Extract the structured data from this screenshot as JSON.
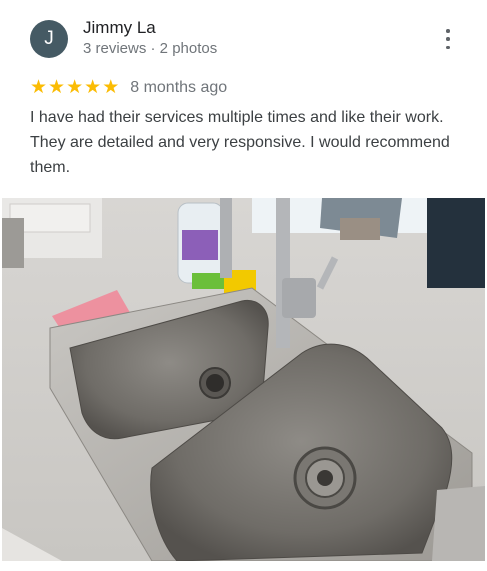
{
  "review": {
    "author_initial": "J",
    "author_name": "Jimmy La",
    "author_meta": "3 reviews · 2 photos",
    "rating": 5,
    "stars": [
      "★",
      "★",
      "★",
      "★",
      "★"
    ],
    "time_ago": "8 months ago",
    "text": "I have had their services multiple times and like their work. They are detailed and very responsive. I would recommend them."
  },
  "colors": {
    "avatar": "#455a64",
    "star": "#fbbc04",
    "secondary_text": "#70757a"
  },
  "icons": {
    "more": "more-vert-icon",
    "star": "star-icon"
  },
  "photo": {
    "subject": "stainless steel double kitchen sink"
  }
}
